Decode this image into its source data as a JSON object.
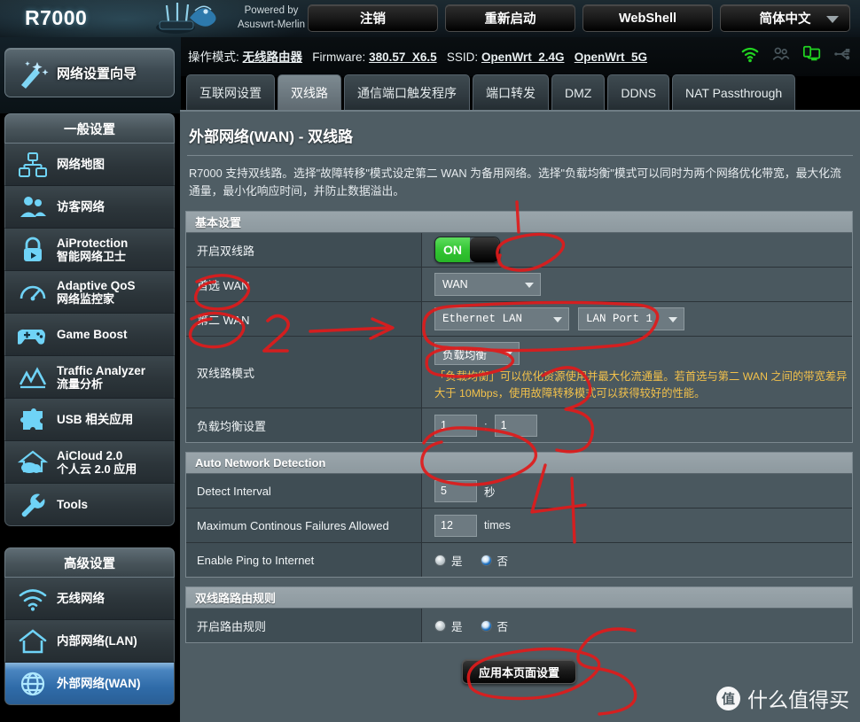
{
  "header": {
    "brand": "R7000",
    "powered_line1": "Powered by",
    "powered_line2": "Asuswrt-Merlin",
    "buttons": {
      "logout": "注销",
      "reboot": "重新启动",
      "webshell": "WebShell",
      "language": "简体中文"
    }
  },
  "infobar": {
    "mode_label": "操作模式:",
    "mode_value": "无线路由器",
    "firmware_label": "Firmware:",
    "firmware_value": "380.57_X6.5",
    "ssid_label": "SSID:",
    "ssid_24": "OpenWrt_2.4G",
    "ssid_5": "OpenWrt_5G",
    "icons": [
      "wifi-icon",
      "guests-icon",
      "clients-icon",
      "usb-icon"
    ],
    "icon_active_color": "#21d421",
    "icon_inactive_color": "#49565c"
  },
  "sidebar": {
    "wizard": {
      "label": "网络设置向导",
      "icon": "magic-wand-icon"
    },
    "groups": [
      {
        "title": "一般设置",
        "items": [
          {
            "label": "网络地图",
            "sub": "",
            "icon": "network-map-icon"
          },
          {
            "label": "访客网络",
            "sub": "",
            "icon": "guest-network-icon"
          },
          {
            "label": "AiProtection",
            "sub": "智能网络卫士",
            "icon": "lock-icon"
          },
          {
            "label": "Adaptive QoS",
            "sub": "网络监控家",
            "icon": "gauge-icon"
          },
          {
            "label": "Game Boost",
            "sub": "",
            "icon": "gamepad-icon"
          },
          {
            "label": "Traffic Analyzer",
            "sub": "流量分析",
            "icon": "chart-icon"
          },
          {
            "label": "USB 相关应用",
            "sub": "",
            "icon": "puzzle-icon"
          },
          {
            "label": "AiCloud 2.0",
            "sub": "个人云 2.0 应用",
            "icon": "cloud-house-icon"
          },
          {
            "label": "Tools",
            "sub": "",
            "icon": "wrench-icon"
          }
        ]
      },
      {
        "title": "高级设置",
        "items": [
          {
            "label": "无线网络",
            "sub": "",
            "icon": "wifi-icon",
            "active": false
          },
          {
            "label": "内部网络(LAN)",
            "sub": "",
            "icon": "house-icon",
            "active": false
          },
          {
            "label": "外部网络(WAN)",
            "sub": "",
            "icon": "globe-icon",
            "active": true
          }
        ]
      }
    ]
  },
  "tabs": [
    {
      "label": "互联网设置",
      "active": false
    },
    {
      "label": "双线路",
      "active": true
    },
    {
      "label": "通信端口触发程序",
      "active": false
    },
    {
      "label": "端口转发",
      "active": false
    },
    {
      "label": "DMZ",
      "active": false
    },
    {
      "label": "DDNS",
      "active": false
    },
    {
      "label": "NAT Passthrough",
      "active": false
    }
  ],
  "page": {
    "title": "外部网络(WAN) - 双线路",
    "description": "R7000 支持双线路。选择\"故障转移\"模式设定第二 WAN 为备用网络。选择\"负载均衡\"模式可以同时为两个网络优化带宽，最大化流通量，最小化响应时间，并防止数据溢出。"
  },
  "sections": [
    {
      "title": "基本设置",
      "rows": [
        {
          "label": "开启双线路",
          "control": "toggle",
          "value": "ON"
        },
        {
          "label": "首选 WAN",
          "control": "select",
          "value": "WAN"
        },
        {
          "label": "第二 WAN",
          "control": "select2",
          "value": "Ethernet LAN",
          "value2": "LAN Port 1"
        },
        {
          "label": "双线路模式",
          "control": "select-hint",
          "value": "负载均衡",
          "hint": "「负载均衡」可以优化资源使用并最大化流通量。若首选与第二 WAN 之间的带宽差异大于 10Mbps，使用故障转移模式可以获得较好的性能。"
        },
        {
          "label": "负载均衡设置",
          "control": "ratio",
          "value": "1",
          "value2": "1",
          "separator": ":"
        }
      ]
    },
    {
      "title": "Auto Network Detection",
      "rows": [
        {
          "label": "Detect Interval",
          "control": "input-unit",
          "value": "5",
          "unit": "秒"
        },
        {
          "label": "Maximum Continous Failures Allowed",
          "control": "input-unit",
          "value": "12",
          "unit": "times"
        },
        {
          "label": "Enable Ping to Internet",
          "control": "radio",
          "yes_label": "是",
          "no_label": "否",
          "selected": "no"
        }
      ]
    },
    {
      "title": "双线路路由规则",
      "rows": [
        {
          "label": "开启路由规则",
          "control": "radio",
          "yes_label": "是",
          "no_label": "否",
          "selected": "no"
        }
      ]
    }
  ],
  "apply_button": "应用本页面设置",
  "watermark": {
    "mark": "值",
    "text": "什么值得买"
  },
  "annotations": {
    "color": "#e01b1b",
    "numbers": [
      "2",
      "4",
      "5"
    ]
  }
}
